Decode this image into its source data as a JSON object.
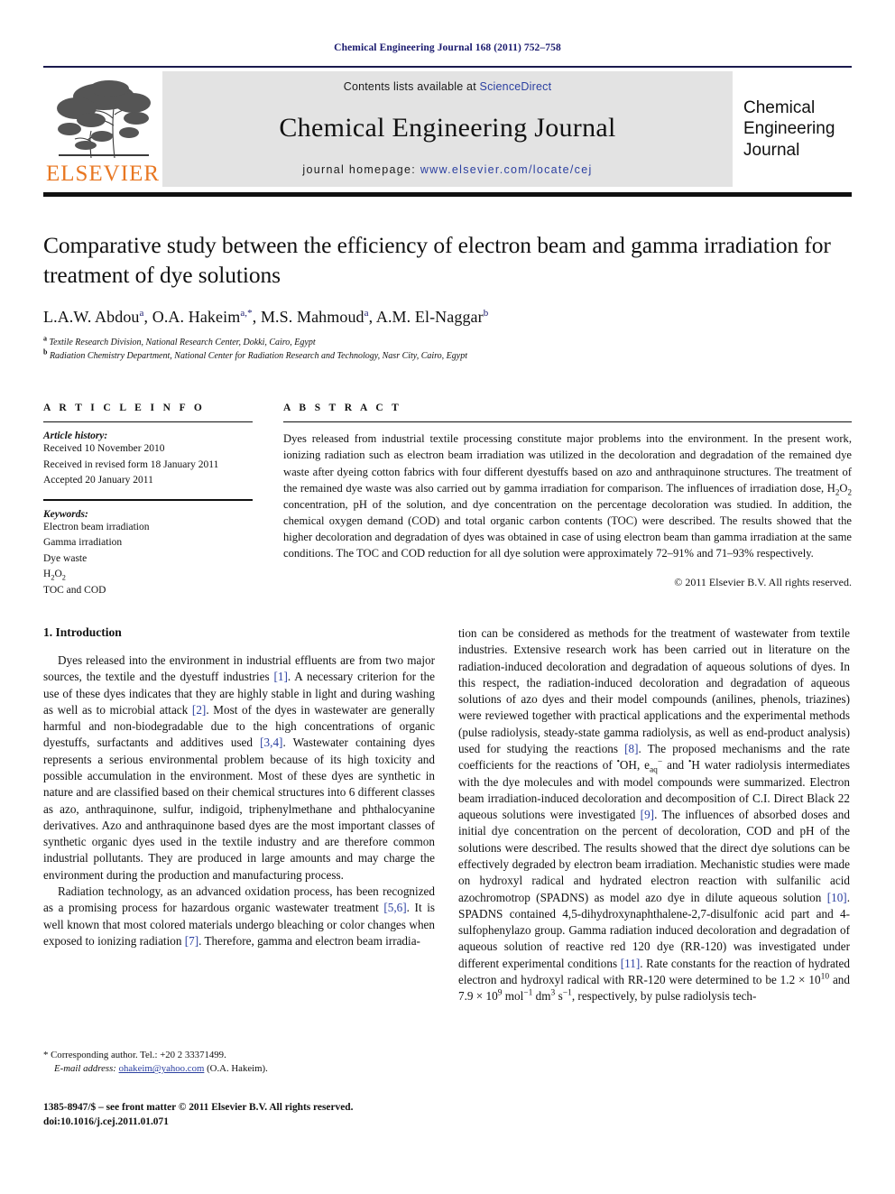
{
  "running_head": "Chemical Engineering Journal 168 (2011) 752–758",
  "masthead": {
    "publisher_wordmark": "ELSEVIER",
    "contents_prefix": "Contents lists available at ",
    "contents_link": "ScienceDirect",
    "journal_title": "Chemical Engineering Journal",
    "homepage_prefix": "journal homepage: ",
    "homepage_url": "www.elsevier.com/locate/cej",
    "cover_line1": "Chemical",
    "cover_line2": "Engineering",
    "cover_line3": "Journal"
  },
  "article": {
    "title": "Comparative study between the efficiency of electron beam and gamma irradiation for treatment of dye solutions",
    "authors_html": "L.A.W. Abdou<sup>a</sup>, O.A. Hakeim<sup>a,*</sup>, M.S. Mahmoud<sup>a</sup>, A.M. El-Naggar<sup>b</sup>",
    "affiliation_a": "Textile Research Division, National Research Center, Dokki, Cairo, Egypt",
    "affiliation_b": "Radiation Chemistry Department, National Center for Radiation Research and Technology, Nasr City, Cairo, Egypt"
  },
  "article_info": {
    "heading": "A R T I C L E   I N F O",
    "history_label": "Article history:",
    "history": [
      "Received 10 November 2010",
      "Received in revised form 18 January 2011",
      "Accepted 20 January 2011"
    ],
    "keywords_label": "Keywords:",
    "keywords_html": [
      "Electron beam irradiation",
      "Gamma irradiation",
      "Dye waste",
      "H<sub>2</sub>O<sub>2</sub>",
      "TOC and COD"
    ]
  },
  "abstract": {
    "heading": "A B S T R A C T",
    "text_html": "Dyes released from industrial textile processing constitute major problems into the environment. In the present work, ionizing radiation such as electron beam irradiation was utilized in the decoloration and degradation of the remained dye waste after dyeing cotton fabrics with four different dyestuffs based on azo and anthraquinone structures. The treatment of the remained dye waste was also carried out by gamma irradiation for comparison. The influences of irradiation dose, H<sub>2</sub>O<sub>2</sub> concentration, pH of the solution, and dye concentration on the percentage decoloration was studied. In addition, the chemical oxygen demand (COD) and total organic carbon contents (TOC) were described. The results showed that the higher decoloration and degradation of dyes was obtained in case of using electron beam than gamma irradiation at the same conditions. The TOC and COD reduction for all dye solution were approximately 72–91% and 71–93% respectively.",
    "copyright": "© 2011 Elsevier B.V. All rights reserved."
  },
  "introduction": {
    "section_number_title": "1.  Introduction",
    "left_para_1_html": "Dyes released into the environment in industrial effluents are from two major sources, the textile and the dyestuff industries <span class=\"ref\">[1]</span>. A necessary criterion for the use of these dyes indicates that they are highly stable in light and during washing as well as to microbial attack <span class=\"ref\">[2]</span>. Most of the dyes in wastewater are generally harmful and non-biodegradable due to the high concentrations of organic dyestuffs, surfactants and additives used <span class=\"ref\">[3,4]</span>. Wastewater containing dyes represents a serious environmental problem because of its high toxicity and possible accumulation in the environment. Most of these dyes are synthetic in nature and are classified based on their chemical structures into 6 different classes as azo, anthraquinone, sulfur, indigoid, triphenylmethane and phthalocyanine derivatives. Azo and anthraquinone based dyes are the most important classes of synthetic organic dyes used in the textile industry and are therefore common industrial pollutants. They are produced in large amounts and may charge the environment during the production and manufacturing process.",
    "left_para_2_html": "Radiation technology, as an advanced oxidation process, has been recognized as a promising process for hazardous organic wastewater treatment <span class=\"ref\">[5,6]</span>. It is well known that most colored materials undergo bleaching or color changes when exposed to ionizing radiation <span class=\"ref\">[7]</span>. Therefore, gamma and electron beam irradia-",
    "right_para_html": "tion can be considered as methods for the treatment of wastewater from textile industries. Extensive research work has been carried out in literature on the radiation-induced decoloration and degradation of aqueous solutions of dyes. In this respect, the radiation-induced decoloration and degradation of aqueous solutions of azo dyes and their model compounds (anilines, phenols, triazines) were reviewed together with practical applications and the experimental methods (pulse radiolysis, steady-state gamma radiolysis, as well as end-product analysis) used for studying the reactions <span class=\"ref\">[8]</span>. The proposed mechanisms and the rate coefficients for the reactions of <sup>•</sup>OH, e<sub>aq</sub><sup>−</sup> and <sup>•</sup>H water radiolysis intermediates with the dye molecules and with model compounds were summarized. Electron beam irradiation-induced decoloration and decomposition of C.I. Direct Black 22 aqueous solutions were investigated <span class=\"ref\">[9]</span>. The influences of absorbed doses and initial dye concentration on the percent of decoloration, COD and pH of the solutions were described. The results showed that the direct dye solutions can be effectively degraded by electron beam irradiation. Mechanistic studies were made on hydroxyl radical and hydrated electron reaction with sulfanilic acid azochromotrop (SPADNS) as model azo dye in dilute aqueous solution <span class=\"ref\">[10]</span>. SPADNS contained 4,5-dihydroxynaphthalene-2,7-disulfonic acid part and 4-sulfophenylazo group. Gamma radiation induced decoloration and degradation of aqueous solution of reactive red 120 dye (RR-120) was investigated under different experimental conditions <span class=\"ref\">[11]</span>. Rate constants for the reaction of hydrated electron and hydroxyl radical with RR-120 were determined to be 1.2 × 10<sup>10</sup> and 7.9 × 10<sup>9</sup> mol<sup>−1</sup> dm<sup>3</sup> s<sup>−1</sup>, respectively, by pulse radiolysis tech-"
  },
  "footnotes": {
    "corresponding_author": "* Corresponding author. Tel.: +20 2 33371499.",
    "email_label": "E-mail address:",
    "email": "ohakeim@yahoo.com",
    "email_suffix": "(O.A. Hakeim).",
    "issn_line": "1385-8947/$ – see front matter © 2011 Elsevier B.V. All rights reserved.",
    "doi_line": "doi:10.1016/j.cej.2011.01.071"
  },
  "colors": {
    "link_blue": "#2b3fa0",
    "elsevier_orange": "#E87722",
    "masthead_gray": "#e3e3e3",
    "running_head_blue": "#1a1a6e"
  }
}
